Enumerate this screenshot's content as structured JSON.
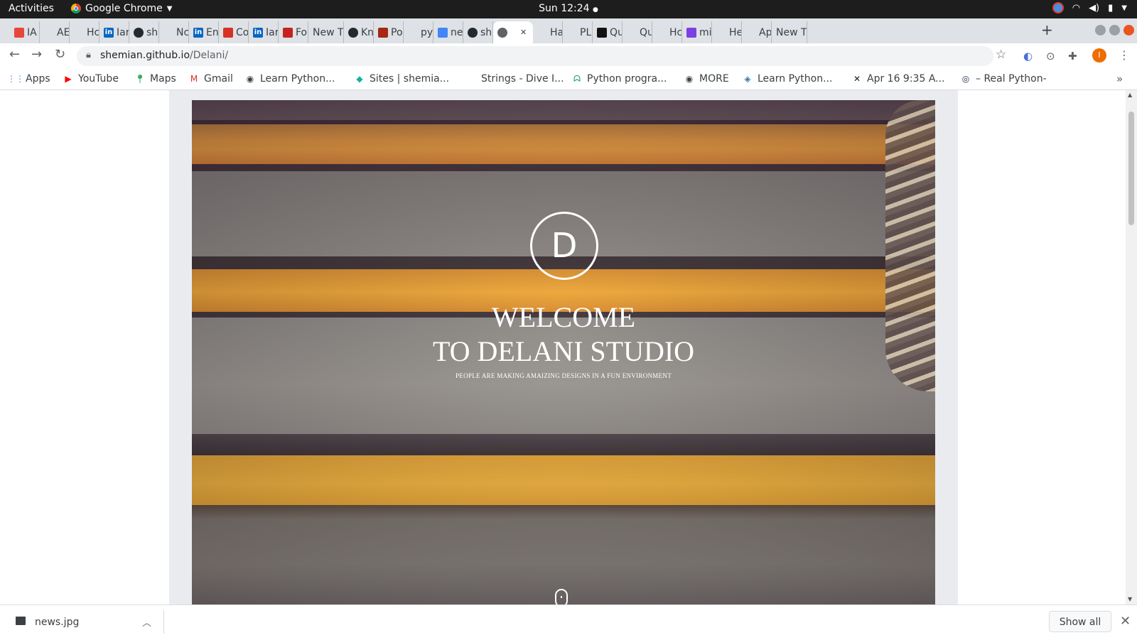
{
  "topbar": {
    "activities": "Activities",
    "app_name": "Google Chrome",
    "clock": "Sun 12:24"
  },
  "tabs": [
    {
      "label": "IA",
      "icon": "g-icon",
      "color": "#e8453c"
    },
    {
      "label": "AE",
      "icon": "blank-icon",
      "color": "#9aa0a6"
    },
    {
      "label": "Hc",
      "icon": "blank-icon",
      "color": "#9aa0a6"
    },
    {
      "label": "Iar",
      "icon": "linkedin-icon",
      "color": "#0a66c2"
    },
    {
      "label": "sh",
      "icon": "github-icon",
      "color": "#24292e"
    },
    {
      "label": "Nc",
      "icon": "blank-icon",
      "color": "#9aa0a6"
    },
    {
      "label": "En",
      "icon": "linkedin-icon",
      "color": "#0a66c2"
    },
    {
      "label": "Co",
      "icon": "gmail-icon",
      "color": "#d93025"
    },
    {
      "label": "Iar",
      "icon": "linkedin-icon",
      "color": "#0a66c2"
    },
    {
      "label": "Fo",
      "icon": "flag-icon",
      "color": "#c5221f"
    },
    {
      "label": "New T",
      "icon": "none",
      "color": ""
    },
    {
      "label": "Kn",
      "icon": "github-icon",
      "color": "#24292e"
    },
    {
      "label": "Po",
      "icon": "image-icon",
      "color": "#a52714"
    },
    {
      "label": "py",
      "icon": "blank-icon",
      "color": "#9aa0a6"
    },
    {
      "label": "ne",
      "icon": "google-icon",
      "color": "#4285f4"
    },
    {
      "label": "sh",
      "icon": "github-icon",
      "color": "#24292e"
    },
    {
      "label": "",
      "icon": "globe-icon",
      "color": "#5f6368",
      "active": true
    },
    {
      "label": "Ha",
      "icon": "blank-icon",
      "color": "#9aa0a6"
    },
    {
      "label": "PL",
      "icon": "blank-icon",
      "color": "#9aa0a6"
    },
    {
      "label": "Qu",
      "icon": "a-icon",
      "color": "#111"
    },
    {
      "label": "Qu",
      "icon": "blank-icon",
      "color": "#9aa0a6"
    },
    {
      "label": "Hc",
      "icon": "blank-icon",
      "color": "#9aa0a6"
    },
    {
      "label": "mi",
      "icon": "h-icon",
      "color": "#7b3fe4"
    },
    {
      "label": "He",
      "icon": "blank-icon",
      "color": "#9aa0a6"
    },
    {
      "label": "Ap",
      "icon": "blank-icon",
      "color": "#9aa0a6"
    },
    {
      "label": "New T",
      "icon": "none",
      "color": ""
    }
  ],
  "address": {
    "domain": "shemian.github.io",
    "path": "/Delani/"
  },
  "profile_initial": "I",
  "bookmarks": [
    {
      "label": "Apps",
      "icon": "apps-grid-icon"
    },
    {
      "label": "YouTube",
      "icon": "youtube-icon"
    },
    {
      "label": "Maps",
      "icon": "maps-pin-icon"
    },
    {
      "label": "Gmail",
      "icon": "gmail-icon"
    },
    {
      "label": "Learn Python...",
      "icon": "globe-icon"
    },
    {
      "label": "Sites | shemia...",
      "icon": "sites-diamond-icon"
    },
    {
      "label": "Strings - Dive I...",
      "icon": "none"
    },
    {
      "label": "Python progra...",
      "icon": "gg-icon"
    },
    {
      "label": "MORE",
      "icon": "globe-icon"
    },
    {
      "label": "Learn Python...",
      "icon": "python-icon"
    },
    {
      "label": "Apr 16 9:35 A...",
      "icon": "cross-arrows-icon"
    },
    {
      "label": "– Real Python-",
      "icon": "realpython-icon"
    }
  ],
  "hero": {
    "logo_letter": "D",
    "title_line1": "WELCOME",
    "title_line2": "TO DELANI STUDIO",
    "subtitle": "PEOPLE ARE MAKING AMAIZING DESIGNS IN A FUN ENVIRONMENT"
  },
  "download": {
    "filename": "news.jpg",
    "show_all": "Show all"
  },
  "colors": {
    "topbar": "#1d1d1d",
    "tabstrip": "#dee1e6",
    "page_frame": "#e9ebef",
    "profile": "#ef6c00"
  }
}
